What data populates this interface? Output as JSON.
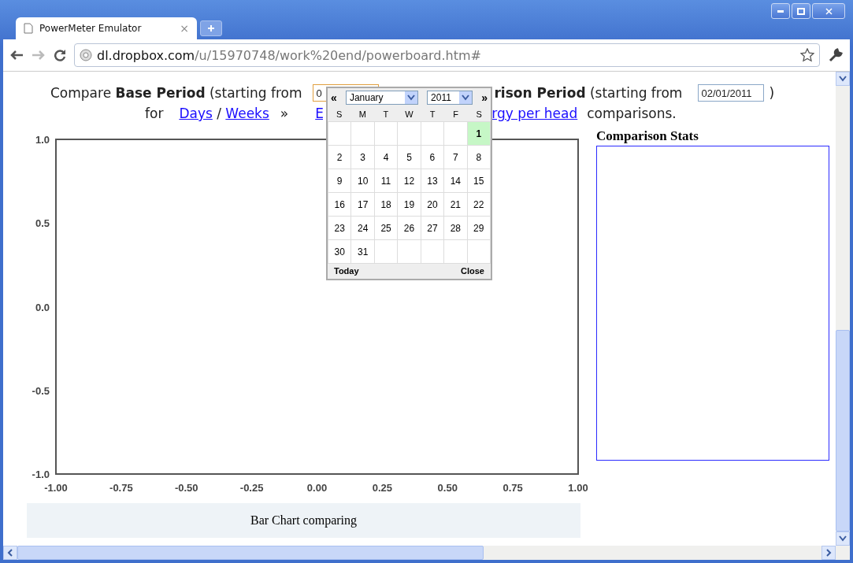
{
  "browser": {
    "tab": {
      "title": "PowerMeter Emulator",
      "close": "×"
    },
    "url": {
      "host": "dl.dropbox.com",
      "path": "/u/15970748/work%20end/powerboard.htm#"
    }
  },
  "form": {
    "line1": {
      "compare": "Compare",
      "base_label": "Base Period",
      "starting": "(starting from",
      "base_value": "0",
      "comparison_label": "rison Period",
      "starting2": "(starting from",
      "comparison_value": "02/01/2011",
      "close_paren": ")"
    },
    "line2": {
      "for": "for",
      "links": [
        {
          "label": "Days"
        },
        {
          "label": "Weeks"
        }
      ],
      "slash": "/",
      "arrow": "»",
      "hidden_link_start": "E",
      "hidden_link_end": "rgy per head",
      "comparisons": "comparisons."
    }
  },
  "calendar": {
    "prev": "«",
    "next": "»",
    "month": "January",
    "year": "2011",
    "weekdays": [
      "S",
      "M",
      "T",
      "W",
      "T",
      "F",
      "S"
    ],
    "weeks": [
      [
        {
          "day": "1",
          "selected": true
        }
      ],
      [
        {
          "day": "2",
          "selected": false
        },
        {
          "day": "3",
          "selected": false
        },
        {
          "day": "4",
          "selected": false
        },
        {
          "day": "5",
          "selected": false
        },
        {
          "day": "6",
          "selected": false
        },
        {
          "day": "7",
          "selected": false
        },
        {
          "day": "8",
          "selected": false
        }
      ],
      [
        {
          "day": "9",
          "selected": false
        },
        {
          "day": "10",
          "selected": false
        },
        {
          "day": "11",
          "selected": false
        },
        {
          "day": "12",
          "selected": false
        },
        {
          "day": "13",
          "selected": false
        },
        {
          "day": "14",
          "selected": false
        },
        {
          "day": "15",
          "selected": false
        }
      ],
      [
        {
          "day": "16",
          "selected": false
        },
        {
          "day": "17",
          "selected": false
        },
        {
          "day": "18",
          "selected": false
        },
        {
          "day": "19",
          "selected": false
        },
        {
          "day": "20",
          "selected": false
        },
        {
          "day": "21",
          "selected": false
        },
        {
          "day": "22",
          "selected": false
        }
      ],
      [
        {
          "day": "23",
          "selected": false
        },
        {
          "day": "24",
          "selected": false
        },
        {
          "day": "25",
          "selected": false
        },
        {
          "day": "26",
          "selected": false
        },
        {
          "day": "27",
          "selected": false
        },
        {
          "day": "28",
          "selected": false
        },
        {
          "day": "29",
          "selected": false
        }
      ],
      [
        {
          "day": "30",
          "selected": false
        },
        {
          "day": "31",
          "selected": false
        }
      ]
    ],
    "today": "Today",
    "close": "Close"
  },
  "chart": {
    "chart_data": {
      "type": "bar",
      "xlim": [
        -1,
        1
      ],
      "ylim": [
        -1,
        1
      ],
      "xticks": [
        {
          "value": -1,
          "label": "-1.00"
        },
        {
          "value": -0.75,
          "label": "-0.75"
        },
        {
          "value": -0.5,
          "label": "-0.50"
        },
        {
          "value": -0.25,
          "label": "-0.25"
        },
        {
          "value": 0,
          "label": "0.00"
        },
        {
          "value": 0.25,
          "label": "0.25"
        },
        {
          "value": 0.5,
          "label": "0.50"
        },
        {
          "value": 0.75,
          "label": "0.75"
        },
        {
          "value": 1,
          "label": "1.00"
        }
      ],
      "yticks": [
        {
          "value": 1,
          "label": "1.0"
        },
        {
          "value": 0.5,
          "label": "0.5"
        },
        {
          "value": 0,
          "label": "0.0"
        },
        {
          "value": -0.5,
          "label": "-0.5"
        },
        {
          "value": -1,
          "label": "-1.0"
        }
      ]
    },
    "caption": "Bar Chart comparing"
  },
  "stats": {
    "title": "Comparison Stats"
  }
}
